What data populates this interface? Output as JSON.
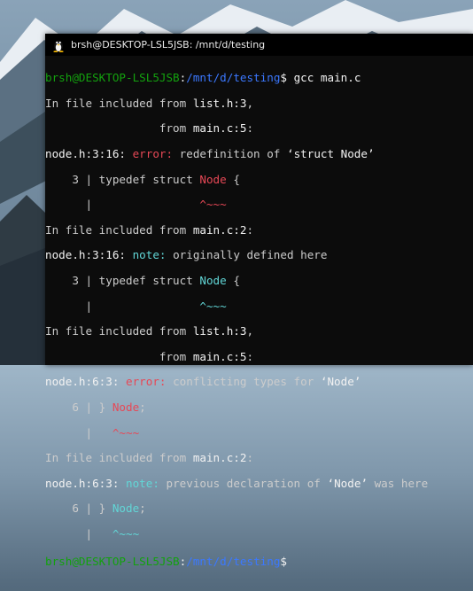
{
  "window": {
    "title": "brsh@DESKTOP-LSL5JSB: /mnt/d/testing"
  },
  "colors": {
    "prompt_user": "#13a10e",
    "prompt_path": "#3b78ff",
    "error": "#e74856",
    "note": "#61d6d6",
    "text": "#cccccc"
  },
  "terminal": {
    "prompt_user": "brsh@DESKTOP-LSL5JSB",
    "prompt_path": "/mnt/d/testing",
    "command": " gcc main.c",
    "l2a": "In file included from ",
    "l2b": "list.h:3",
    "l2c": ",",
    "l3a": "                 from ",
    "l3b": "main.c:5",
    "l3c": ":",
    "l4a": "node.h:3:16: ",
    "l4b": "error: ",
    "l4c": "redefinition of ",
    "l4d": "‘struct Node’",
    "l5a": "    3 | typedef struct ",
    "l5b": "Node",
    "l5c": " {",
    "l6a": "      |                ",
    "l6b": "^~~~",
    "l7a": "In file included from ",
    "l7b": "main.c:2",
    "l7c": ":",
    "l8a": "node.h:3:16: ",
    "l8b": "note: ",
    "l8c": "originally defined here",
    "l9a": "    3 | typedef struct ",
    "l9b": "Node",
    "l9c": " {",
    "l10a": "      |                ",
    "l10b": "^~~~",
    "l11a": "In file included from ",
    "l11b": "list.h:3",
    "l11c": ",",
    "l12a": "                 from ",
    "l12b": "main.c:5",
    "l12c": ":",
    "l13a": "node.h:6:3: ",
    "l13b": "error: ",
    "l13c": "conflicting types for ",
    "l13d": "‘Node’",
    "l14a": "    6 | } ",
    "l14b": "Node",
    "l14c": ";",
    "l15a": "      |   ",
    "l15b": "^~~~",
    "l16a": "In file included from ",
    "l16b": "main.c:2",
    "l16c": ":",
    "l17a": "node.h:6:3: ",
    "l17b": "note: ",
    "l17c": "previous declaration of ",
    "l17d": "‘Node’",
    "l17e": " was here",
    "l18a": "    6 | } ",
    "l18b": "Node",
    "l18c": ";",
    "l19a": "      |   ",
    "l19b": "^~~~",
    "dollar": "$"
  }
}
